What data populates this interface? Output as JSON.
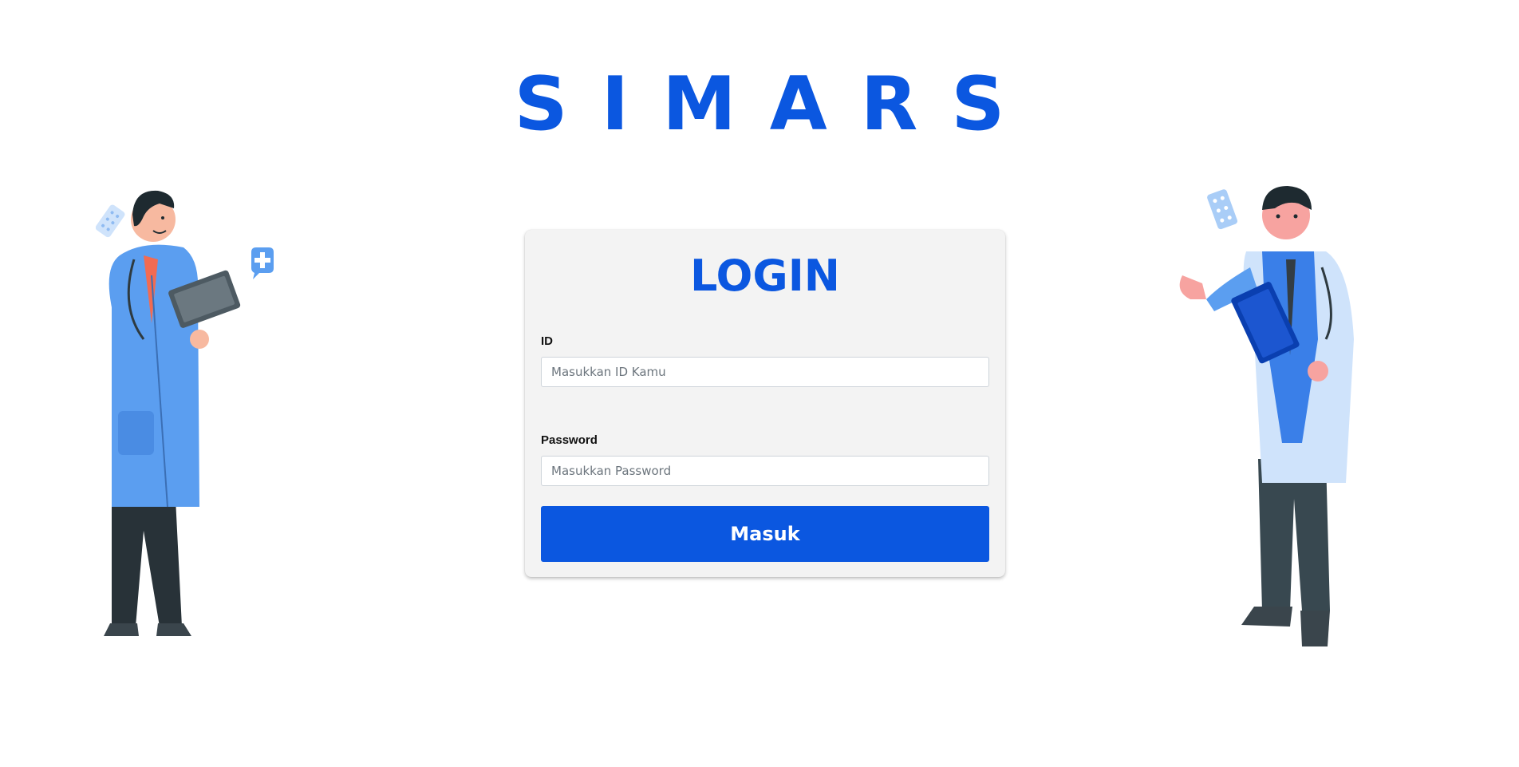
{
  "brand": {
    "title": "SIMARS"
  },
  "login": {
    "title": "LOGIN",
    "id_label": "ID",
    "id_placeholder": "Masukkan ID Kamu",
    "password_label": "Password",
    "password_placeholder": "Masukkan Password",
    "submit_label": "Masuk"
  },
  "illustrations": {
    "left": "doctor-writing-clipboard-illustration",
    "right": "doctor-presenting-clipboard-illustration"
  },
  "colors": {
    "brand": "#0b57e0",
    "card_background": "#f3f3f3",
    "page_background": "#ffffff"
  }
}
